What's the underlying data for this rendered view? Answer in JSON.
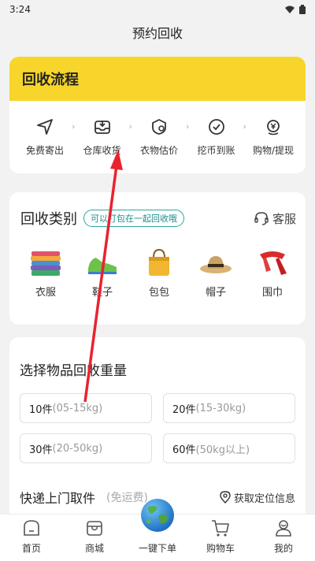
{
  "status": {
    "time": "3:24"
  },
  "header": {
    "title": "预约回收"
  },
  "flow": {
    "title": "回收流程",
    "steps": [
      {
        "label": "免费寄出",
        "icon": "send-icon"
      },
      {
        "label": "仓库收货",
        "icon": "inbox-icon"
      },
      {
        "label": "衣物估价",
        "icon": "appraise-icon"
      },
      {
        "label": "挖币到账",
        "icon": "check-circle-icon"
      },
      {
        "label": "购物/提现",
        "icon": "coin-icon"
      }
    ]
  },
  "category": {
    "title": "回收类别",
    "tag": "可以打包在一起回收哦",
    "service": "客服",
    "items": [
      {
        "label": "衣服",
        "icon": "clothes-icon"
      },
      {
        "label": "鞋子",
        "icon": "shoes-icon"
      },
      {
        "label": "包包",
        "icon": "bag-icon"
      },
      {
        "label": "帽子",
        "icon": "hat-icon"
      },
      {
        "label": "围巾",
        "icon": "scarf-icon"
      }
    ]
  },
  "weight": {
    "title": "选择物品回收重量",
    "options": [
      {
        "main": "10件",
        "sub": "(05-15kg)"
      },
      {
        "main": "20件",
        "sub": "(15-30kg)"
      },
      {
        "main": "30件",
        "sub": "(20-50kg)"
      },
      {
        "main": "60件",
        "sub": "(50kg以上)"
      }
    ]
  },
  "shipping": {
    "title": "快递上门取件",
    "note": "(免运费)",
    "location": "获取定位信息"
  },
  "tabbar": {
    "items": [
      {
        "label": "首页",
        "icon": "home-icon"
      },
      {
        "label": "商城",
        "icon": "store-icon"
      },
      {
        "label": "一键下单",
        "icon": "globe-icon"
      },
      {
        "label": "购物车",
        "icon": "cart-icon"
      },
      {
        "label": "我的",
        "icon": "profile-icon"
      }
    ]
  },
  "colors": {
    "accent": "#f7d52a",
    "tag": "#2aa6a0",
    "annotation": "#e8232f"
  }
}
